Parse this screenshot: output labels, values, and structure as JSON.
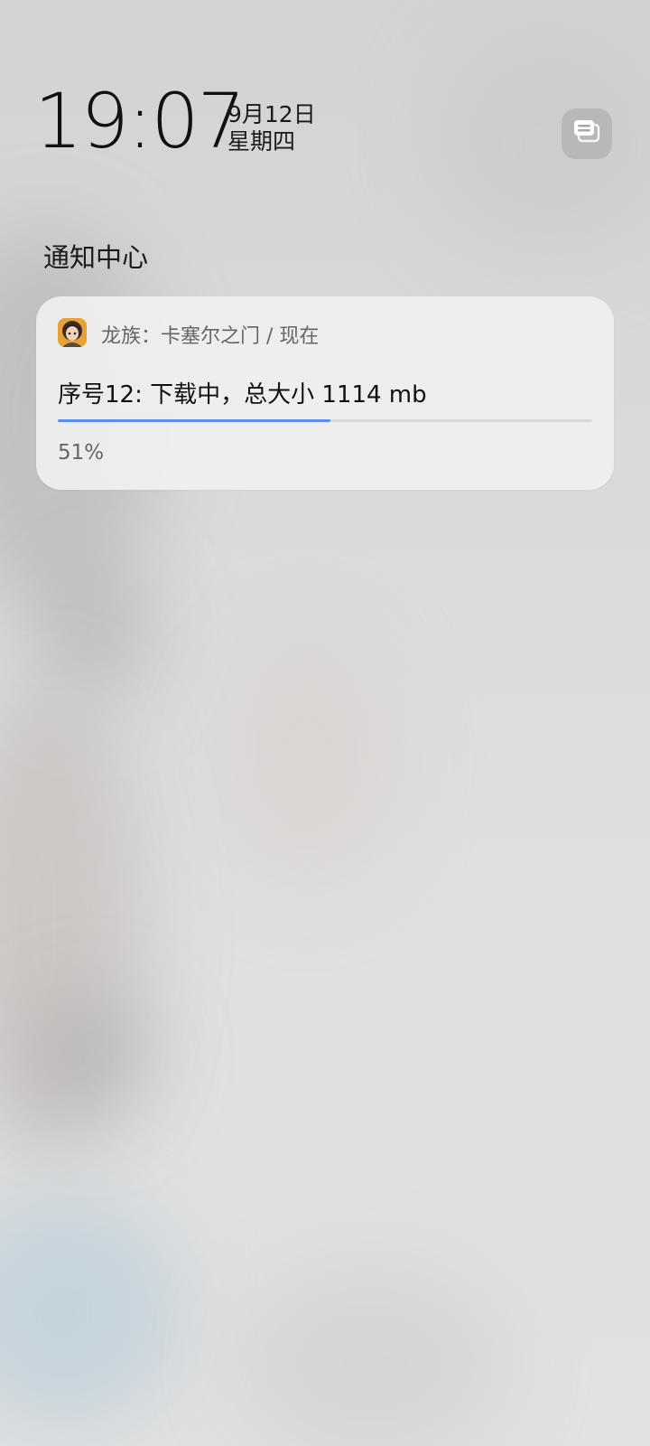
{
  "clock": {
    "time": "19:07",
    "date": "9月12日",
    "weekday": "星期四"
  },
  "notification_center": {
    "title": "通知中心",
    "manage_icon": "notification-manage-icon"
  },
  "notification": {
    "app_icon": "game-app-icon",
    "app_line": "龙族：卡塞尔之门 / 现在",
    "title": "序号12: 下载中，总大小 1114 mb",
    "progress_percent": 51,
    "progress_text": "51%",
    "progress_color": "#5b8def"
  }
}
